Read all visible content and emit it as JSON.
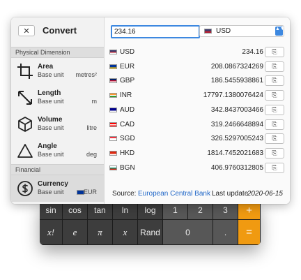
{
  "window": {
    "title": "Convert",
    "close_glyph": "✕"
  },
  "sidebar": {
    "sections": [
      {
        "label": "Physical Dimension"
      },
      {
        "label": "Financial"
      }
    ],
    "items": [
      {
        "name": "Area",
        "base_label": "Base unit",
        "unit": "metres²",
        "icon": "crop-icon"
      },
      {
        "name": "Length",
        "base_label": "Base unit",
        "unit": "m",
        "icon": "diagonal-arrows-icon"
      },
      {
        "name": "Volume",
        "base_label": "Base unit",
        "unit": "litre",
        "icon": "cube-icon"
      },
      {
        "name": "Angle",
        "base_label": "Base unit",
        "unit": "deg",
        "icon": "triangle-icon"
      },
      {
        "name": "Currency",
        "base_label": "Base unit",
        "unit": "EUR",
        "icon": "dollar-circle-icon",
        "selected": true
      }
    ]
  },
  "converter": {
    "amount": "234.16",
    "currency_select": {
      "value": "USD",
      "arrows": "▲▼"
    },
    "copy_glyph": "⎘",
    "rates": [
      {
        "code": "USD",
        "value": "234.16",
        "flag": [
          "#3c3b6e",
          "#b22234",
          "#ffffff"
        ]
      },
      {
        "code": "EUR",
        "value": "208.0867324269",
        "flag": [
          "#003399",
          "#003399",
          "#ffcc00"
        ]
      },
      {
        "code": "GBP",
        "value": "186.5455938861",
        "flag": [
          "#012169",
          "#c8102e",
          "#ffffff"
        ]
      },
      {
        "code": "INR",
        "value": "17797.1380076424",
        "flag": [
          "#ff9933",
          "#ffffff",
          "#138808"
        ]
      },
      {
        "code": "AUD",
        "value": "342.8437003466",
        "flag": [
          "#00008b",
          "#00008b",
          "#ffffff"
        ]
      },
      {
        "code": "CAD",
        "value": "319.2466648894",
        "flag": [
          "#ff0000",
          "#ffffff",
          "#ff0000"
        ]
      },
      {
        "code": "SGD",
        "value": "326.5297005243",
        "flag": [
          "#ef3340",
          "#ffffff",
          "#ffffff"
        ]
      },
      {
        "code": "HKD",
        "value": "1814.7452021683",
        "flag": [
          "#de2910",
          "#de2910",
          "#ffffff"
        ]
      },
      {
        "code": "BGN",
        "value": "406.9760312805",
        "flag": [
          "#ffffff",
          "#00966e",
          "#d62612"
        ]
      }
    ]
  },
  "footer": {
    "source_label": "Source:",
    "source_name": "European Central Bank",
    "update_label": "Last update",
    "update_date": "2020-06-15"
  },
  "calculator": {
    "row1": [
      "sin",
      "cos",
      "tan",
      "ln",
      "log",
      "1",
      "2",
      "3",
      "+"
    ],
    "row2": [
      "x!",
      "e",
      "π",
      "x",
      "Rand",
      "0",
      ".",
      "="
    ]
  },
  "colors": {
    "accent": "#3d88e0",
    "link": "#2067c8",
    "operator": "#f09a11"
  }
}
